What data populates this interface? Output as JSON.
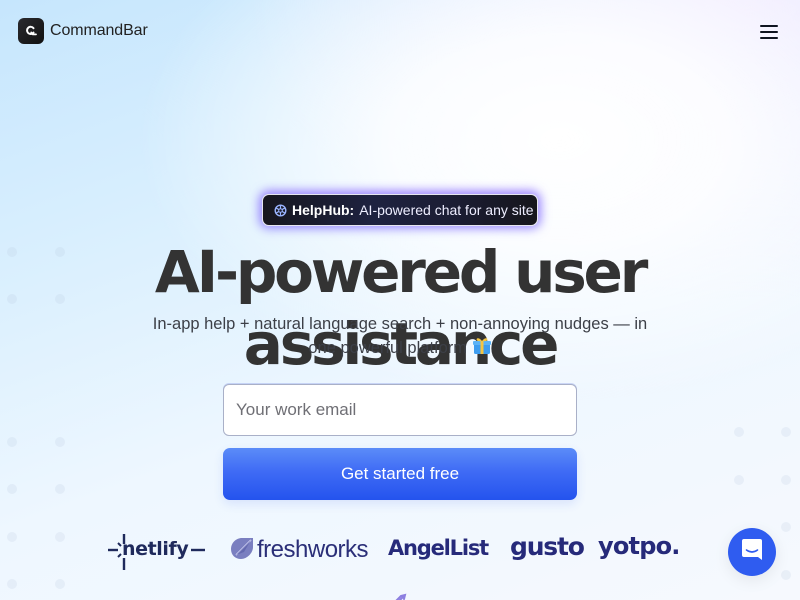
{
  "nav": {
    "brand_name": "CommandBar",
    "brand_icon": "commandbar-logo-icon",
    "menu_icon": "hamburger-menu-icon"
  },
  "announcement": {
    "icon": "helphub-icon",
    "strong": "HelpHub:",
    "text": "AI-powered chat for any site"
  },
  "hero": {
    "title": "AI-powered user assistance",
    "subtitle": "In-app help + natural language search + non-annoying nudges — in one powerful platform",
    "subtitle_emoji": "gift-icon"
  },
  "signup": {
    "email_placeholder": "Your work email",
    "email_value": "",
    "cta_label": "Get started free"
  },
  "customer_logos": [
    {
      "name": "netlify",
      "label": "netlify"
    },
    {
      "name": "freshworks",
      "label": "freshworks"
    },
    {
      "name": "angellist",
      "label": "AngelList"
    },
    {
      "name": "gusto",
      "label": "gusto"
    },
    {
      "name": "yotpo",
      "label": "yotpo."
    }
  ],
  "chat_widget": {
    "icon": "chat-bubble-icon"
  },
  "colors": {
    "accent": "#2f5cf0",
    "cta_top": "#5b8cf8",
    "cta_bottom": "#2453ee",
    "title": "#333333",
    "logo_navy": "#262a7a",
    "pill_bg": "#17171f"
  }
}
